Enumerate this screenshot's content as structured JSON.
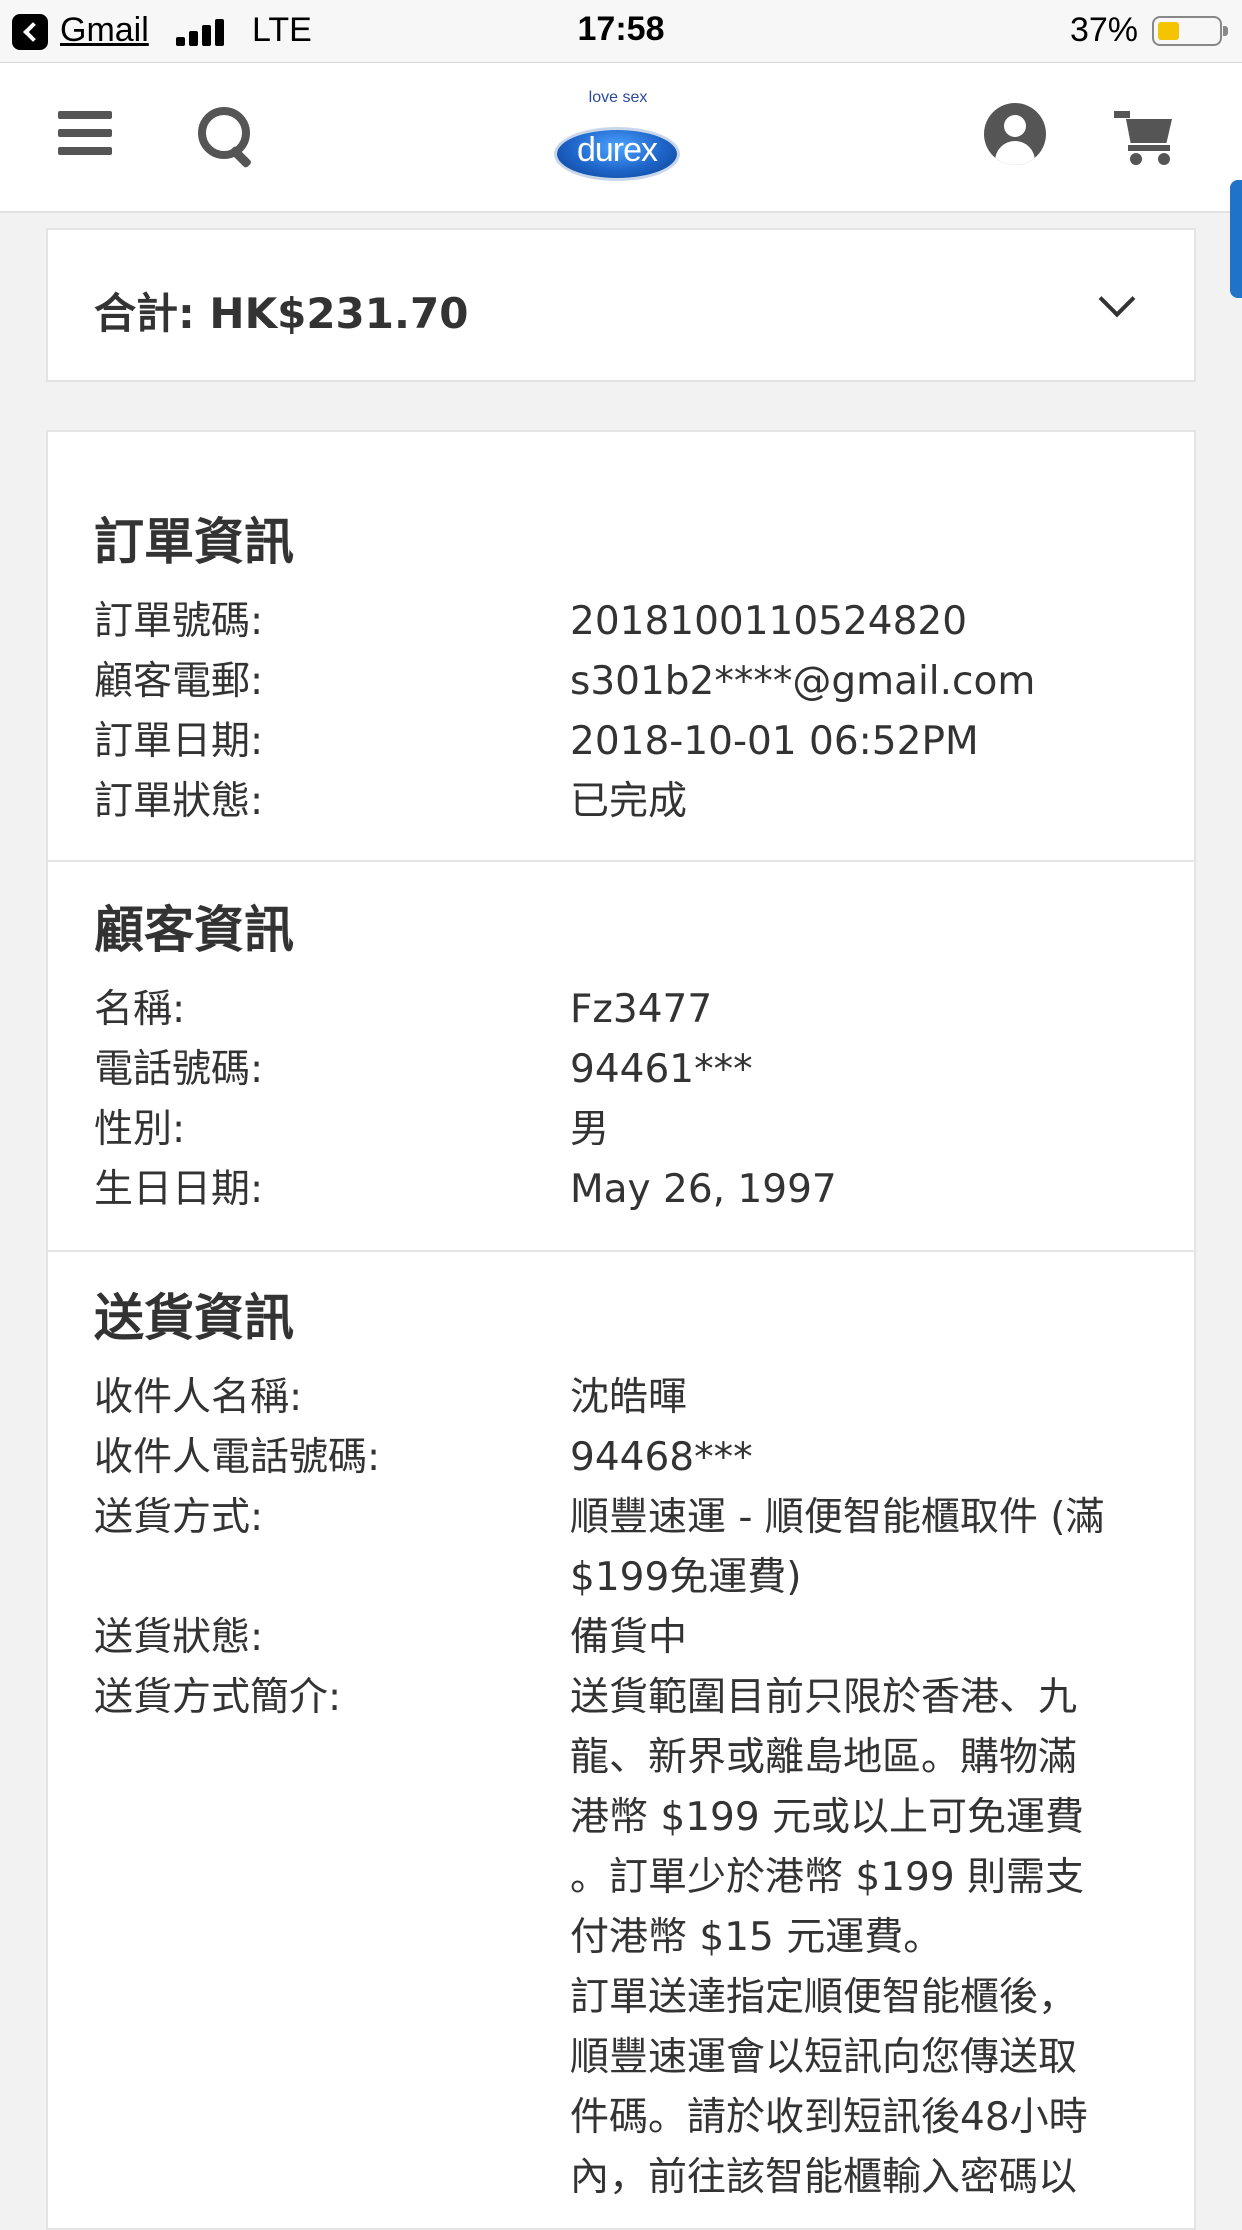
{
  "status_bar": {
    "back_app": "Gmail",
    "network": "LTE",
    "time": "17:58",
    "battery_percent": "37%",
    "battery_level": 0.37,
    "battery_color": "#f5c400"
  },
  "header": {
    "icons": [
      "menu-icon",
      "search-icon",
      "account-icon",
      "cart-icon"
    ],
    "logo_tagline": "love sex",
    "logo_text": "durex",
    "brand_color": "#1d64c8"
  },
  "total": {
    "label": "合計: HK$231.70"
  },
  "order_info": {
    "title": "訂單資訊",
    "rows": [
      {
        "label": "訂單號碼:",
        "value": "2018100110524820"
      },
      {
        "label": "顧客電郵:",
        "value": "s301b2****@gmail.com"
      },
      {
        "label": "訂單日期:",
        "value": "2018-10-01 06:52PM"
      },
      {
        "label": "訂單狀態:",
        "value": "已完成"
      }
    ]
  },
  "customer_info": {
    "title": "顧客資訊",
    "rows": [
      {
        "label": "名稱:",
        "value": "Fz3477"
      },
      {
        "label": "電話號碼:",
        "value": "94461***"
      },
      {
        "label": "性別:",
        "value": "男"
      },
      {
        "label": "生日日期:",
        "value": "May 26, 1997"
      }
    ]
  },
  "delivery_info": {
    "title": "送貨資訊",
    "rows": [
      {
        "label": "收件人名稱:",
        "value_lines": [
          "沈皓暉"
        ]
      },
      {
        "label": "收件人電話號碼:",
        "value_lines": [
          "94468***"
        ]
      },
      {
        "label": "送貨方式:",
        "value_lines": [
          "順豐速運 - 順便智能櫃取件 (滿",
          "$199免運費)"
        ]
      },
      {
        "label": "送貨狀態:",
        "value_lines": [
          "備貨中"
        ]
      },
      {
        "label": "送貨方式簡介:",
        "value_lines": [
          "送貨範圍目前只限於香港、九",
          "龍、新界或離島地區。購物滿",
          "港幣 $199 元或以上可免運費",
          "。訂單少於港幣 $199 則需支",
          "付港幣 $15 元運費。",
          "訂單送達指定順便智能櫃後，",
          "順豐速運會以短訊向您傳送取",
          "件碼。請於收到短訊後48小時",
          "內，前往該智能櫃輸入密碼以"
        ]
      }
    ]
  }
}
